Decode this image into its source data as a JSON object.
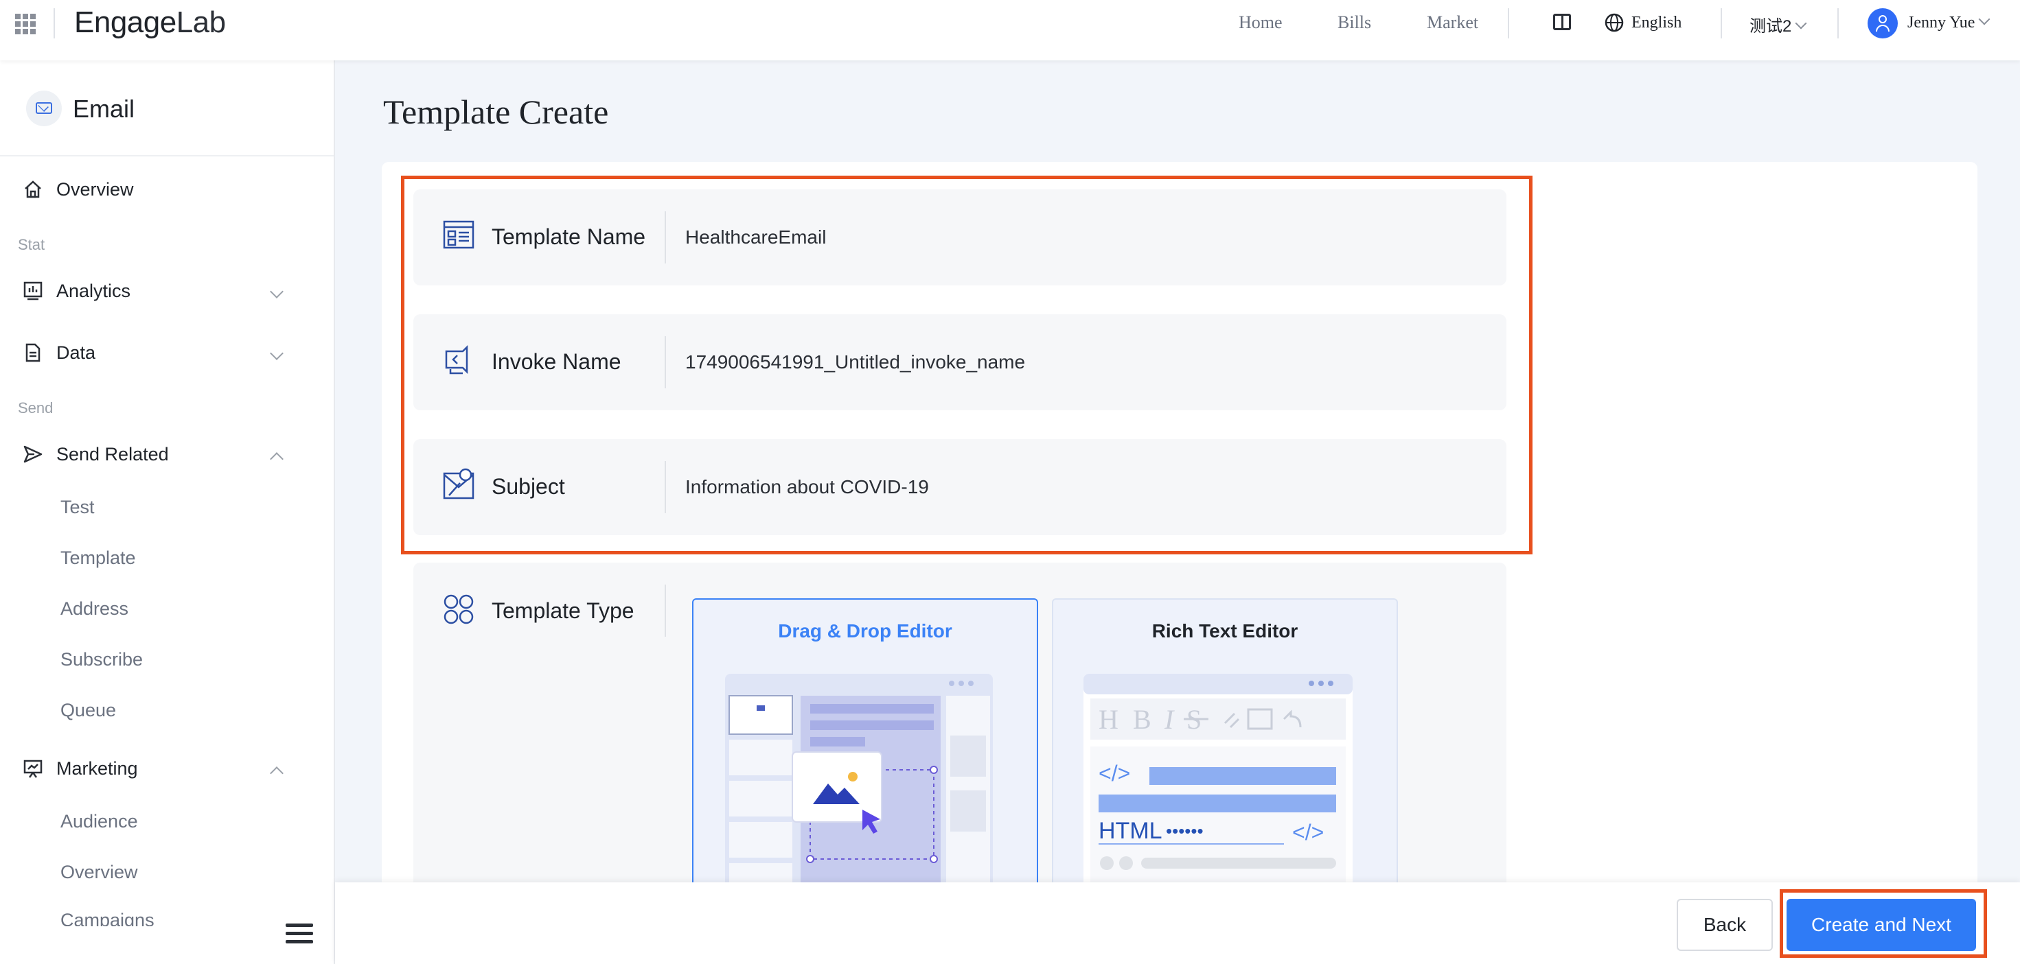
{
  "header": {
    "logo_main": "Engage",
    "logo_suffix": "Lab",
    "nav": [
      "Home",
      "Bills",
      "Market"
    ],
    "language": "English",
    "org": "测试2",
    "user": "Jenny Yue"
  },
  "sidebar": {
    "title": "Email",
    "overview": "Overview",
    "group_stat": "Stat",
    "analytics": "Analytics",
    "data": "Data",
    "group_send": "Send",
    "send_related": "Send Related",
    "send_sub": [
      "Test",
      "Template",
      "Address",
      "Subscribe",
      "Queue"
    ],
    "marketing": "Marketing",
    "marketing_sub": [
      "Audience",
      "Overview",
      "Campaigns"
    ]
  },
  "main": {
    "page_title": "Template Create",
    "fields": {
      "template_name_label": "Template Name",
      "template_name_value": "HealthcareEmail",
      "invoke_name_label": "Invoke Name",
      "invoke_name_value": "1749006541991_Untitled_invoke_name",
      "subject_label": "Subject",
      "subject_value": "Information about COVID-19"
    },
    "template_type_label": "Template Type",
    "editors": {
      "drag_drop": "Drag & Drop Editor",
      "rich_text": "Rich Text Editor",
      "html_text": "HTML",
      "code_tag": "</>"
    }
  },
  "actions": {
    "back": "Back",
    "create_next": "Create and Next"
  },
  "colors": {
    "primary": "#2f7bf6",
    "highlight": "#e8501e",
    "selected_border": "#3b82f6"
  }
}
